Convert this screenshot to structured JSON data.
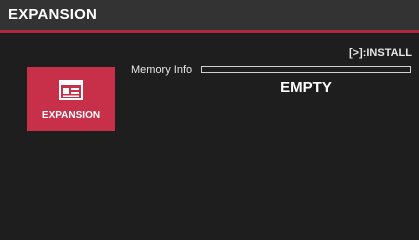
{
  "header": {
    "title": "EXPANSION"
  },
  "hint": {
    "install_label": "[>]:INSTALL"
  },
  "tile": {
    "label": "EXPANSION",
    "icon": "expansion-card-icon"
  },
  "memory": {
    "label": "Memory Info",
    "usage_fraction": 0,
    "status": "EMPTY"
  },
  "colors": {
    "header_bg": "#333333",
    "accent": "#c73048",
    "rule": "#b0283e",
    "background": "#1e1e1e"
  }
}
